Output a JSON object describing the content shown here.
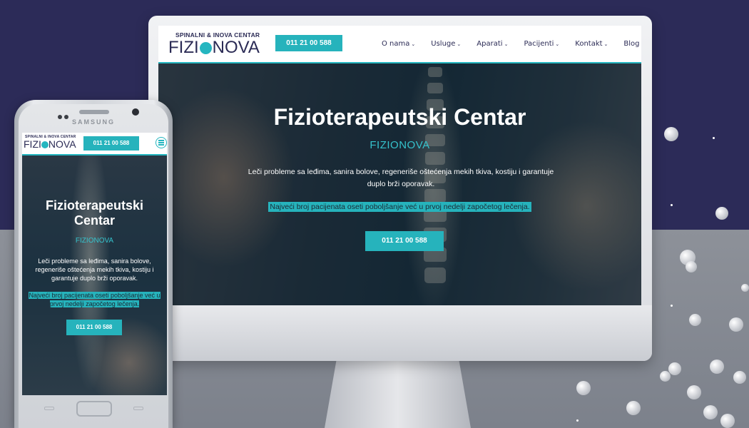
{
  "brand": {
    "logo_small": "SPINALNI & INOVA CENTAR",
    "logo_part1": "FIZI",
    "logo_part2": "NOVA"
  },
  "phone_number": "011 21 00 588",
  "nav": {
    "items": [
      {
        "label": "O nama",
        "icon": "chevron-down-icon"
      },
      {
        "label": "Usluge",
        "icon": "chevron-down-icon"
      },
      {
        "label": "Aparati",
        "icon": "chevron-down-icon"
      },
      {
        "label": "Pacijenti",
        "icon": "chevron-down-icon"
      },
      {
        "label": "Kontakt",
        "icon": "chevron-down-icon"
      },
      {
        "label": "Blog",
        "icon": "chevron-down-icon"
      }
    ]
  },
  "hero": {
    "title": "Fizioterapeutski Centar",
    "title_line1": "Fizioterapeutski",
    "title_line2": "Centar",
    "subtitle": "FIZIONOVA",
    "description": "Leči probleme sa leđima, sanira bolove, regeneriše oštećenja mekih tkiva, kostiju i garantuje duplo brži oporavak.",
    "highlight": "Najveći broj pacijenata oseti poboljšanje već u prvoj nedelji započetog lečenja.",
    "cta_label": "011 21 00 588"
  },
  "device": {
    "phone_brand": "SAMSUNG",
    "menu_icon": "menu-icon"
  },
  "colors": {
    "accent": "#26b3bc",
    "navy": "#2b2b55",
    "background_top": "#2c2b58",
    "background_bottom": "#878c96"
  }
}
